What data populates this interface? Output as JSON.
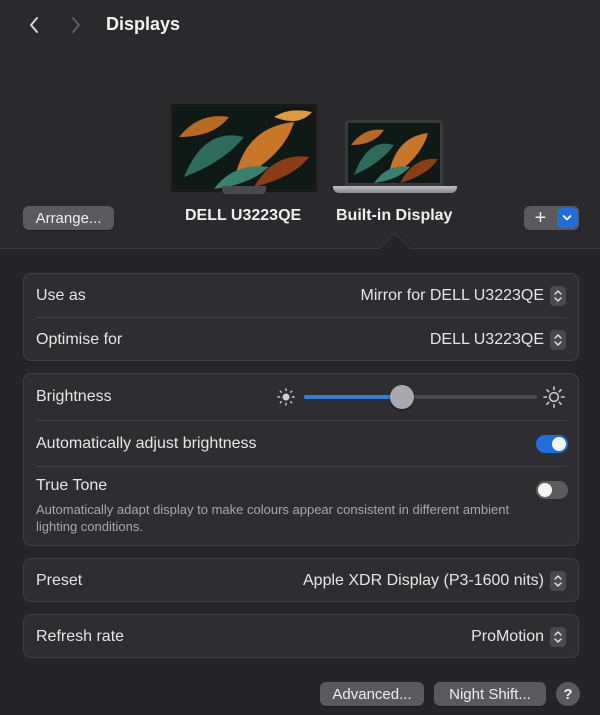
{
  "window": {
    "title": "Displays"
  },
  "toolbar": {
    "back_icon": "chevron-left-icon",
    "forward_icon": "chevron-right-icon"
  },
  "arrangement": {
    "arrange_label": "Arrange...",
    "displays": [
      {
        "label": "DELL U3223QE",
        "selected": false
      },
      {
        "label": "Built-in Display",
        "selected": true
      }
    ],
    "add_label": "+"
  },
  "display_settings": {
    "use_as": {
      "label": "Use as",
      "value": "Mirror for DELL U3223QE"
    },
    "optimise_for": {
      "label": "Optimise for",
      "value": "DELL U3223QE"
    }
  },
  "brightness": {
    "label": "Brightness",
    "level": 0.42,
    "auto_adjust": {
      "label": "Automatically adjust brightness",
      "on": true
    },
    "true_tone": {
      "label": "True Tone",
      "description": "Automatically adapt display to make colours appear consistent in different ambient lighting conditions.",
      "on": false
    }
  },
  "preset": {
    "label": "Preset",
    "value": "Apple XDR Display (P3-1600 nits)"
  },
  "refresh_rate": {
    "label": "Refresh rate",
    "value": "ProMotion"
  },
  "footer": {
    "advanced_label": "Advanced...",
    "night_shift_label": "Night Shift...",
    "help_label": "?"
  },
  "colors": {
    "accent": "#2f7fe0",
    "toggle_on": "#1e6fd9",
    "toggle_off": "#5c5c5f"
  }
}
